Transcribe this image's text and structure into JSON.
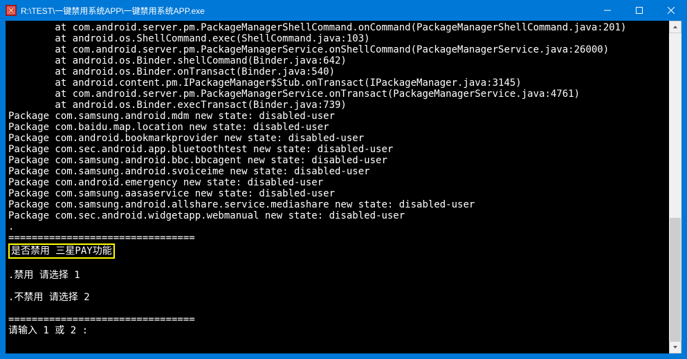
{
  "window": {
    "title": "R:\\TEST\\一键禁用系统APP\\一键禁用系统APP.exe"
  },
  "console": {
    "lines": [
      "        at com.android.server.pm.PackageManagerShellCommand.onCommand(PackageManagerShellCommand.java:201)",
      "        at android.os.ShellCommand.exec(ShellCommand.java:103)",
      "        at com.android.server.pm.PackageManagerService.onShellCommand(PackageManagerService.java:26000)",
      "        at android.os.Binder.shellCommand(Binder.java:642)",
      "        at android.os.Binder.onTransact(Binder.java:540)",
      "        at android.content.pm.IPackageManager$Stub.onTransact(IPackageManager.java:3145)",
      "        at com.android.server.pm.PackageManagerService.onTransact(PackageManagerService.java:4761)",
      "        at android.os.Binder.execTransact(Binder.java:739)",
      "Package com.samsung.android.mdm new state: disabled-user",
      "Package com.baidu.map.location new state: disabled-user",
      "Package com.android.bookmarkprovider new state: disabled-user",
      "Package com.sec.android.app.bluetoothtest new state: disabled-user",
      "Package com.samsung.android.bbc.bbcagent new state: disabled-user",
      "Package com.samsung.android.svoiceime new state: disabled-user",
      "Package com.android.emergency new state: disabled-user",
      "Package com.samsung.aasaservice new state: disabled-user",
      "Package com.samsung.android.allshare.service.mediashare new state: disabled-user",
      "Package com.sec.android.widgetapp.webmanual new state: disabled-user",
      ".",
      "================================"
    ],
    "highlight": "是否禁用 三星PAY功能",
    "after_highlight": [
      "",
      ".禁用 请选择 1",
      "",
      ".不禁用 请选择 2",
      "",
      "================================",
      "请输入 1 或 2 :"
    ]
  },
  "scrollbar": {
    "thumb_top_pct": 60,
    "thumb_height_pct": 40
  }
}
